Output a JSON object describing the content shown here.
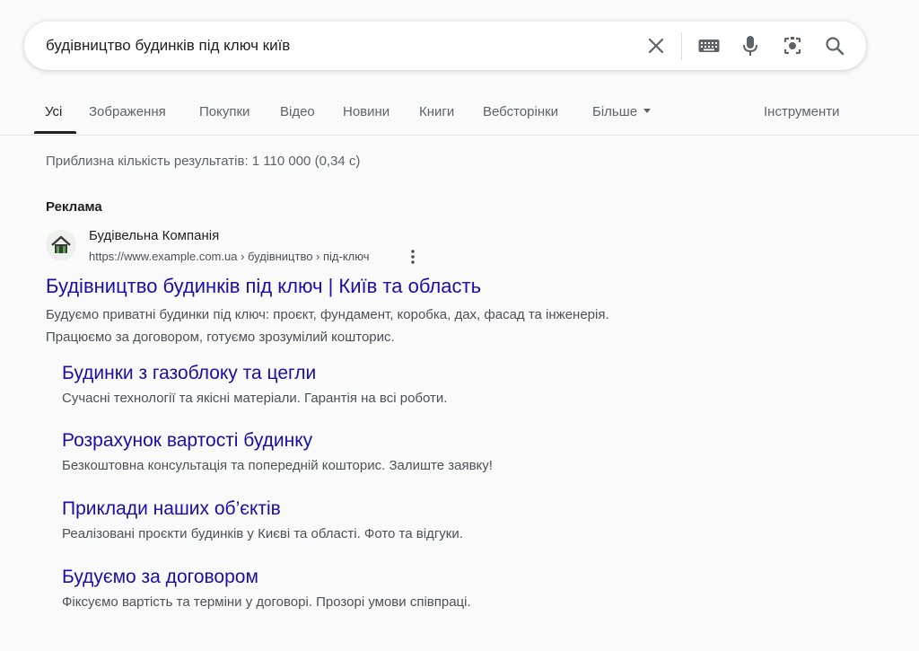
{
  "search": {
    "query": "будівництво будинків під ключ київ",
    "icons": [
      "close-icon",
      "keyboard-icon",
      "microphone-icon",
      "lens-icon",
      "search-icon"
    ]
  },
  "tabs": {
    "items": [
      {
        "label": "Усі",
        "active": true
      },
      {
        "label": "Зображення"
      },
      {
        "label": "Покупки"
      },
      {
        "label": "Відео"
      },
      {
        "label": "Новини"
      },
      {
        "label": "Книги"
      },
      {
        "label": "Вебсторінки"
      },
      {
        "label": "Більше"
      }
    ],
    "tools_label": "Інструменти"
  },
  "results": {
    "stats": "Приблизна кількість результатів: 1 110 000 (0,34 с)",
    "ad_label": "Реклама",
    "ad": {
      "advertiser": "Будівельна Компанія",
      "url": "https://www.example.com.ua › будівництво › під-ключ",
      "headline": "Будівництво будинків під ключ | Київ та область",
      "description_lines": [
        "Будуємо приватні будинки під ключ: проєкт, фундамент, коробка, дах, фасад та інженерія.",
        "Працюємо за договором, готуємо зрозумілий кошторис."
      ],
      "sitelinks": [
        {
          "title": "Будинки з газоблоку та цегли",
          "description": "Сучасні технології та якісні матеріали. Гарантія на всі роботи."
        },
        {
          "title": "Розрахунок вартості будинку",
          "description": "Безкоштовна консультація та попередній кошторис. Залиште заявку!"
        },
        {
          "title": "Приклади наших об’єктів",
          "description": "Реалізовані проєкти будинків у Києві та області. Фото та відгуки."
        },
        {
          "title": "Будуємо за договором",
          "description": "Фіксуємо вартість та терміни у договорі. Прозорі умови співпраці."
        }
      ]
    }
  },
  "colors": {
    "link": "#1a0dab",
    "text": "#202124",
    "secondary": "#4d5156",
    "background": "#fafafa"
  }
}
